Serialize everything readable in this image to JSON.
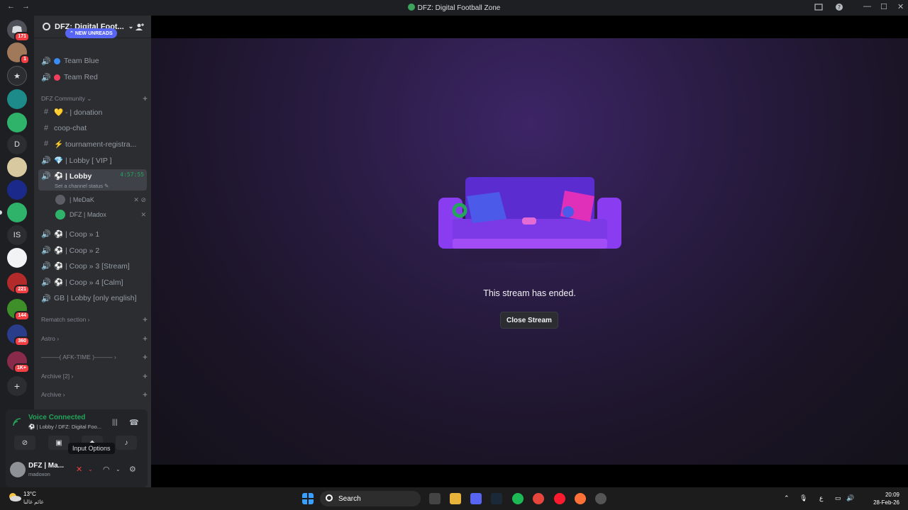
{
  "window": {
    "title": "DFZ: Digital Football Zone"
  },
  "guilds": {
    "badges": [
      "171",
      "1",
      "221",
      "144",
      "360",
      "1K+"
    ],
    "letters": [
      "D",
      "IS"
    ]
  },
  "server": {
    "name": "DFZ: Digital Foot..."
  },
  "new_unreads": "NEW UNREADS",
  "channels_top": [
    {
      "label": "Team Blue",
      "color": "#3a8df5"
    },
    {
      "label": "Team Red",
      "color": "#f23f5f"
    }
  ],
  "categories": {
    "community": "DFZ Community",
    "rematch": "Rematch section",
    "astro": "Astro",
    "afk": "———( AFK-TIME )———",
    "archive2": "Archive [2]",
    "archive": "Archive"
  },
  "community_channels": [
    {
      "label": "💛 - | donation",
      "icon": "#"
    },
    {
      "label": "coop-chat",
      "icon": "#"
    },
    {
      "label": "⚡ tournament-registra...",
      "icon": "#"
    },
    {
      "label": "💎 | Lobby [ VIP ]",
      "icon": "🔊"
    }
  ],
  "active_channel": {
    "label": "⚽ | Lobby",
    "time": "4:57:55",
    "status": "Set a channel status"
  },
  "voice_users": [
    {
      "name": "| MeDaK"
    },
    {
      "name": "DFZ | Madox"
    }
  ],
  "coop_channels": [
    {
      "label": "⚽ | Coop » 1"
    },
    {
      "label": "⚽ | Coop » 2"
    },
    {
      "label": "⚽ | Coop » 3 [Stream]"
    },
    {
      "label": "⚽ | Coop » 4 [Calm]"
    },
    {
      "label": "GB | Lobby [only english]"
    }
  ],
  "voice_panel": {
    "title": "Voice Connected",
    "subtitle": "⚽ | Lobby / DFZ: Digital Foo...",
    "tooltip": "Input Options"
  },
  "user": {
    "name": "DFZ | Ma...",
    "tag": "madoxon"
  },
  "stream": {
    "message": "This stream has ended.",
    "close_label": "Close Stream"
  },
  "taskbar": {
    "temp": "13°C",
    "weather": "غائم غالبا",
    "search_placeholder": "Search",
    "lang": "ع",
    "time": "20:09",
    "date": "28-Feb-26"
  },
  "colors": {
    "accent": "#5865f2",
    "voice_green": "#23a55a",
    "danger": "#f23f43"
  }
}
